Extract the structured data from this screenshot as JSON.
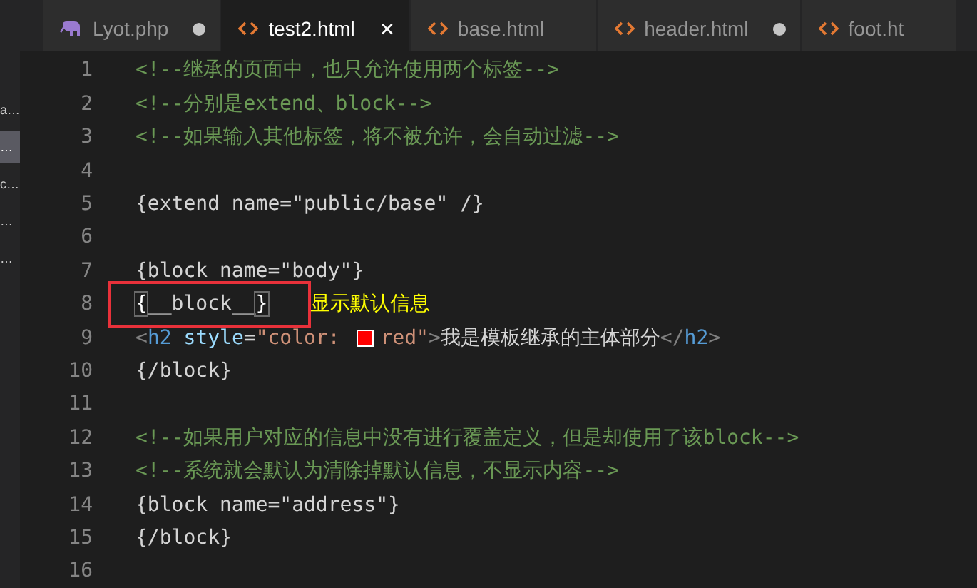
{
  "sidebar": {
    "items": [
      {
        "label": "a…",
        "selected": false
      },
      {
        "label": "…",
        "selected": true
      },
      {
        "label": "c…",
        "selected": false
      },
      {
        "label": "…",
        "selected": false
      },
      {
        "label": "…",
        "selected": false
      }
    ]
  },
  "tabs": [
    {
      "label": "Lyot.php",
      "kind": "php",
      "selected": false,
      "modified": true
    },
    {
      "label": "test2.html",
      "kind": "html",
      "selected": true,
      "modified": false,
      "close": "✕"
    },
    {
      "label": "base.html",
      "kind": "html",
      "selected": false,
      "modified": false
    },
    {
      "label": "header.html",
      "kind": "html",
      "selected": false,
      "modified": true
    },
    {
      "label": "foot.ht",
      "kind": "html",
      "selected": false,
      "modified": false
    }
  ],
  "editor": {
    "lines": [
      {
        "number": "1",
        "tokens": [
          {
            "kind": "comment",
            "text": "<!--继承的页面中，也只允许使用两个标签-->"
          }
        ]
      },
      {
        "number": "2",
        "tokens": [
          {
            "kind": "comment",
            "text": "<!--分别是extend、block-->"
          }
        ]
      },
      {
        "number": "3",
        "tokens": [
          {
            "kind": "comment",
            "text": "<!--如果输入其他标签，将不被允许，会自动过滤-->"
          }
        ]
      },
      {
        "number": "4"
      },
      {
        "number": "5",
        "tokens": [
          {
            "kind": "text",
            "text": "{extend name=\"public/base\" /}"
          }
        ]
      },
      {
        "number": "6"
      },
      {
        "number": "7",
        "tokens": [
          {
            "kind": "text",
            "text": "{block name=\"body\"}"
          }
        ]
      },
      {
        "number": "8",
        "tokens": [
          {
            "kind": "bracket",
            "text": "{"
          },
          {
            "kind": "text",
            "text": "__block__"
          },
          {
            "kind": "bracket",
            "text": "}"
          }
        ],
        "annotation": "显示默认信息"
      },
      {
        "number": "9",
        "tokens": [
          {
            "kind": "punct",
            "text": "<"
          },
          {
            "kind": "tag",
            "text": "h2"
          },
          {
            "kind": "attr",
            "text": " style"
          },
          {
            "kind": "text",
            "text": "="
          },
          {
            "kind": "string",
            "text": "\"color: "
          },
          {
            "kind": "swatch",
            "color": "#ff0000"
          },
          {
            "kind": "string",
            "text": "red\""
          },
          {
            "kind": "punct",
            "text": ">"
          },
          {
            "kind": "text",
            "text": "我是模板继承的主体部分"
          },
          {
            "kind": "punct",
            "text": "</"
          },
          {
            "kind": "tag",
            "text": "h2"
          },
          {
            "kind": "punct",
            "text": ">"
          }
        ]
      },
      {
        "number": "10",
        "tokens": [
          {
            "kind": "text",
            "text": "{/block}"
          }
        ]
      },
      {
        "number": "11"
      },
      {
        "number": "12",
        "tokens": [
          {
            "kind": "comment",
            "text": "<!--如果用户对应的信息中没有进行覆盖定义，但是却使用了该block-->"
          }
        ]
      },
      {
        "number": "13",
        "tokens": [
          {
            "kind": "comment",
            "text": "<!--系统就会默认为清除掉默认信息，不显示内容-->"
          }
        ]
      },
      {
        "number": "14",
        "tokens": [
          {
            "kind": "text",
            "text": "{block name=\"address\"}"
          }
        ]
      },
      {
        "number": "15",
        "tokens": [
          {
            "kind": "text",
            "text": "{/block}"
          }
        ]
      },
      {
        "number": "16"
      }
    ]
  }
}
